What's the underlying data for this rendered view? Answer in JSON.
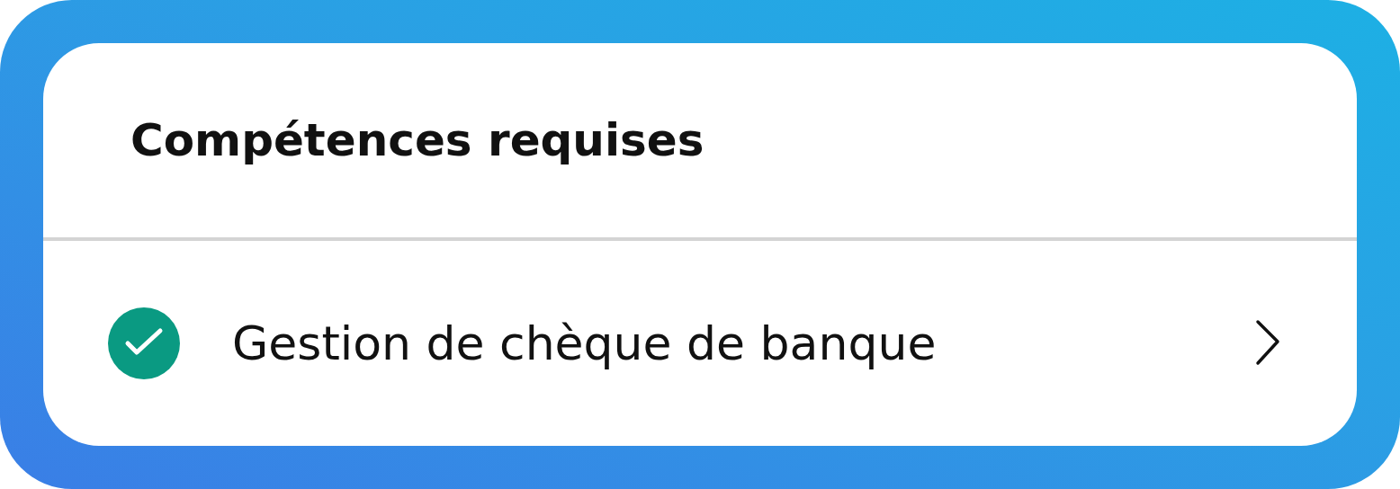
{
  "card": {
    "title": "Compétences requises",
    "items": [
      {
        "label": "Gestion de chèque de banque",
        "checked": true
      }
    ]
  }
}
